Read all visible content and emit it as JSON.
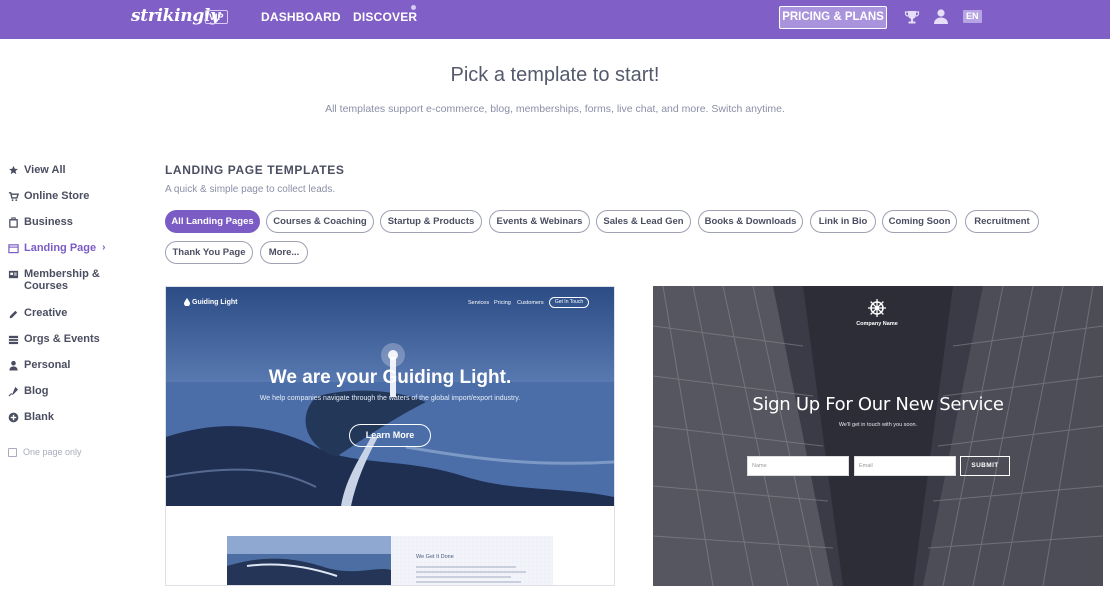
{
  "topbar": {
    "logo": "strikingly",
    "vip_badge": "VIP",
    "nav": [
      {
        "label": "DASHBOARD"
      },
      {
        "label": "DISCOVER"
      }
    ],
    "pricing_label": "PRICING & PLANS",
    "language": "EN",
    "bg_color": "#8060c6"
  },
  "header": {
    "title": "Pick a template to start!",
    "subtitle": "All templates support e-commerce, blog, memberships, forms, live chat, and more. Switch anytime."
  },
  "sidebar": {
    "items": [
      {
        "label": "View All",
        "icon": "star-icon"
      },
      {
        "label": "Online Store",
        "icon": "cart-icon"
      },
      {
        "label": "Business",
        "icon": "briefcase-icon"
      },
      {
        "label": "Landing Page",
        "icon": "landing-page-icon",
        "active": true
      },
      {
        "label": "Membership &",
        "label2": "Courses",
        "icon": "membership-icon"
      },
      {
        "label": "Creative",
        "icon": "palette-icon"
      },
      {
        "label": "Orgs & Events",
        "icon": "events-icon"
      },
      {
        "label": "Personal",
        "icon": "person-icon"
      },
      {
        "label": "Blog",
        "icon": "pen-icon"
      },
      {
        "label": "Blank",
        "icon": "plus-circle-icon"
      }
    ],
    "one_page_only_label": "One page only",
    "one_page_only_checked": false
  },
  "section": {
    "title": "LANDING PAGE TEMPLATES",
    "subtitle": "A quick & simple page to collect leads.",
    "active_color": "#7a5cc4",
    "filters": [
      {
        "label": "All Landing Pages",
        "active": true
      },
      {
        "label": "Courses & Coaching"
      },
      {
        "label": "Startup & Products"
      },
      {
        "label": "Events & Webinars"
      },
      {
        "label": "Sales & Lead Gen"
      },
      {
        "label": "Books & Downloads"
      },
      {
        "label": "Link in Bio"
      },
      {
        "label": "Coming Soon"
      },
      {
        "label": "Recruitment"
      },
      {
        "label": "Thank You Page"
      },
      {
        "label": "More..."
      }
    ]
  },
  "templates": [
    {
      "brand": "Guiding Light",
      "nav": [
        "Services",
        "Pricing",
        "Customers"
      ],
      "nav_button": "Get In Touch",
      "headline": "We are your Guiding Light.",
      "subline": "We help companies navigate through the waters of the global import/export industry.",
      "cta": "Learn More",
      "lower_title": "We Get It Done"
    },
    {
      "brand": "Company Name",
      "headline": "Sign Up For Our New Service",
      "subline": "We'll get in touch with you soon.",
      "name_placeholder": "Name",
      "email_placeholder": "Email",
      "submit": "SUBMIT"
    }
  ]
}
